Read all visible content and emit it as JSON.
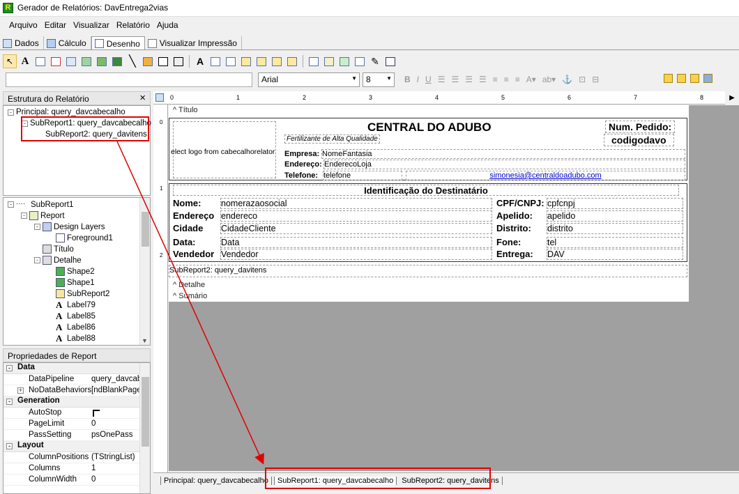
{
  "window": {
    "title": "Gerador de Relatórios: DavEntrega2vias",
    "icon_letter": "R"
  },
  "menu": [
    "Arquivo",
    "Editar",
    "Visualizar",
    "Relatório",
    "Ajuda"
  ],
  "tabs": [
    {
      "label": "Dados",
      "icon": "data-icon"
    },
    {
      "label": "Cálculo",
      "icon": "calc-icon"
    },
    {
      "label": "Desenho",
      "icon": "design-icon",
      "active": true
    },
    {
      "label": "Visualizar Impressão",
      "icon": "preview-icon"
    }
  ],
  "format_toolbar": {
    "font": "Arial",
    "size": "8"
  },
  "structure_panel": {
    "title": "Estrutura do Relatório",
    "close": "×",
    "items": [
      "Principal: query_davcabecalho",
      "SubReport1: query_davcabecalho",
      "SubReport2: query_davitens"
    ]
  },
  "object_tree": {
    "items": [
      {
        "label": "SubReport1",
        "depth": 0,
        "icon": "dots-icon",
        "toggle": "-"
      },
      {
        "label": "Report",
        "depth": 1,
        "icon": "report-icon",
        "toggle": "-"
      },
      {
        "label": "Design Layers",
        "depth": 2,
        "icon": "layers-icon",
        "toggle": "-"
      },
      {
        "label": "Foreground1",
        "depth": 3,
        "icon": "layer-icon"
      },
      {
        "label": "Título",
        "depth": 2,
        "icon": "band-icon"
      },
      {
        "label": "Detalhe",
        "depth": 2,
        "icon": "band-icon",
        "toggle": "-"
      },
      {
        "label": "Shape2",
        "depth": 3,
        "icon": "shape-icon"
      },
      {
        "label": "Shape1",
        "depth": 3,
        "icon": "shape-icon"
      },
      {
        "label": "SubReport2",
        "depth": 3,
        "icon": "subreport-icon"
      },
      {
        "label": "Label79",
        "depth": 3,
        "icon": "label-icon"
      },
      {
        "label": "Label85",
        "depth": 3,
        "icon": "label-icon"
      },
      {
        "label": "Label86",
        "depth": 3,
        "icon": "label-icon"
      },
      {
        "label": "Label88",
        "depth": 3,
        "icon": "label-icon"
      }
    ]
  },
  "properties": {
    "title": "Propriedades de Report",
    "groups": [
      {
        "name": "Data",
        "rows": [
          [
            "DataPipeline",
            "query_davcabe"
          ],
          [
            "NoDataBehaviors",
            "[ndBlankPage]"
          ]
        ]
      },
      {
        "name": "Generation",
        "rows": [
          [
            "AutoStop",
            ""
          ],
          [
            "PageLimit",
            "0"
          ],
          [
            "PassSetting",
            "psOnePass"
          ]
        ]
      },
      {
        "name": "Layout",
        "rows": [
          [
            "ColumnPositions",
            "(TStringList)"
          ],
          [
            "Columns",
            "1"
          ],
          [
            "ColumnWidth",
            "0"
          ]
        ]
      }
    ]
  },
  "ruler": {
    "marks": [
      "0",
      "1",
      "2",
      "3",
      "4",
      "5",
      "6",
      "7",
      "8"
    ],
    "vmarks": [
      "0",
      "1",
      "2"
    ]
  },
  "report": {
    "band_titulo": "Título",
    "band_detalhe": "Detalhe",
    "band_sumario": "Sumário",
    "logo_text": "elect logo from cabecalhorelator",
    "company_title": "CENTRAL DO ADUBO",
    "slogan": "Fertilizante de Alta Qualidade",
    "num_pedido_label": "Num. Pedido:",
    "num_pedido_value": "codigodavo",
    "empresa_label": "Empresa:",
    "empresa_value": "NomeFantasia",
    "endereco_label": "Endereço:",
    "endereco_value": "EnderecoLoja",
    "telefone_label": "Telefone:",
    "telefone_value": "telefone",
    "email": "simonesia@centraldoadubo.com",
    "dest_title": "Identificação do Destinatário",
    "fields": [
      {
        "l": "Nome:",
        "v": "nomerazaosocial",
        "l2": "CPF/CNPJ:",
        "v2": "cpfcnpj"
      },
      {
        "l": "Endereço",
        "v": "endereco",
        "l2": "Apelido:",
        "v2": "apelido"
      },
      {
        "l": "Cidade",
        "v": "CidadeCliente",
        "l2": "Distrito:",
        "v2": "distrito"
      },
      {
        "l": "Data:",
        "v": "Data",
        "l2": "Fone:",
        "v2": "tel"
      },
      {
        "l": "Vendedor",
        "v": "Vendedor",
        "l2": "Entrega:",
        "v2": "DAV"
      }
    ],
    "subreport2_label": "SubReport2: query_davitens"
  },
  "bottom_tabs": [
    "Principal: query_davcabecalho",
    "SubReport1: query_davcabecalho",
    "SubReport2: query_davitens"
  ]
}
